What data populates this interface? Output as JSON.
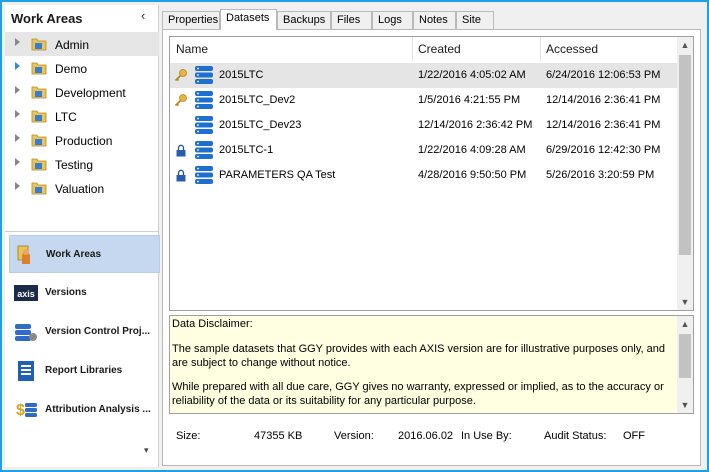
{
  "sidebar": {
    "title": "Work Areas",
    "collapse_glyph": "‹",
    "tree": [
      {
        "label": "Admin",
        "selected": true
      },
      {
        "label": "Demo",
        "arrow": "blue"
      },
      {
        "label": "Development"
      },
      {
        "label": "LTC"
      },
      {
        "label": "Production"
      },
      {
        "label": "Testing"
      },
      {
        "label": "Valuation"
      }
    ],
    "nav": [
      {
        "label": "Work Areas",
        "icon": "work-areas-icon",
        "active": true
      },
      {
        "label": "Versions",
        "icon": "axis-logo-icon"
      },
      {
        "label": "Version Control Proj...",
        "icon": "version-control-icon"
      },
      {
        "label": "Report Libraries",
        "icon": "report-library-icon"
      },
      {
        "label": "Attribution Analysis ...",
        "icon": "attribution-analysis-icon"
      }
    ],
    "more_glyph": "▾"
  },
  "tabs": [
    "Properties",
    "Datasets",
    "Backups",
    "Files",
    "Logs",
    "Notes",
    "Site"
  ],
  "active_tab": "Datasets",
  "datasets": {
    "columns": [
      "Name",
      "Created",
      "Accessed"
    ],
    "rows": [
      {
        "name": "2015LTC",
        "created": "1/22/2016 4:05:02 AM",
        "accessed": "6/24/2016 12:06:53 PM",
        "flag": "key-icon",
        "selected": true
      },
      {
        "name": "2015LTC_Dev2",
        "created": "1/5/2016 4:21:55 PM",
        "accessed": "12/14/2016 2:36:41 PM",
        "flag": "key-icon"
      },
      {
        "name": "2015LTC_Dev23",
        "created": "12/14/2016 2:36:42 PM",
        "accessed": "12/14/2016 2:36:41 PM",
        "flag": ""
      },
      {
        "name": "2015LTC-1",
        "created": "1/22/2016 4:09:28 AM",
        "accessed": "6/29/2016 12:42:30 PM",
        "flag": "lock-icon"
      },
      {
        "name": "PARAMETERS QA Test",
        "created": "4/28/2016 9:50:50 PM",
        "accessed": "5/26/2016 3:20:59 PM",
        "flag": "lock-icon"
      }
    ]
  },
  "disclaimer": {
    "title": "Data Disclaimer:",
    "para1": "The sample datasets that GGY provides with each AXIS version are for illustrative purposes only, and are subject to change without notice.",
    "para2": "While prepared with all due care, GGY gives no warranty, expressed or implied, as to the accuracy or reliability of the data or its suitability for any particular purpose."
  },
  "status": {
    "size_label": "Size:",
    "size_value": "47355 KB",
    "version_label": "Version:",
    "version_value": "2016.06.02",
    "inuse_label": "In Use By:",
    "inuse_value": "",
    "audit_label": "Audit Status:",
    "audit_value": "OFF"
  },
  "colors": {
    "window_border": "#1ea0e8",
    "active_nav": "#c5d8ef",
    "disclaimer_bg": "#ffffe1",
    "db_icon": "#1f6fd1"
  }
}
